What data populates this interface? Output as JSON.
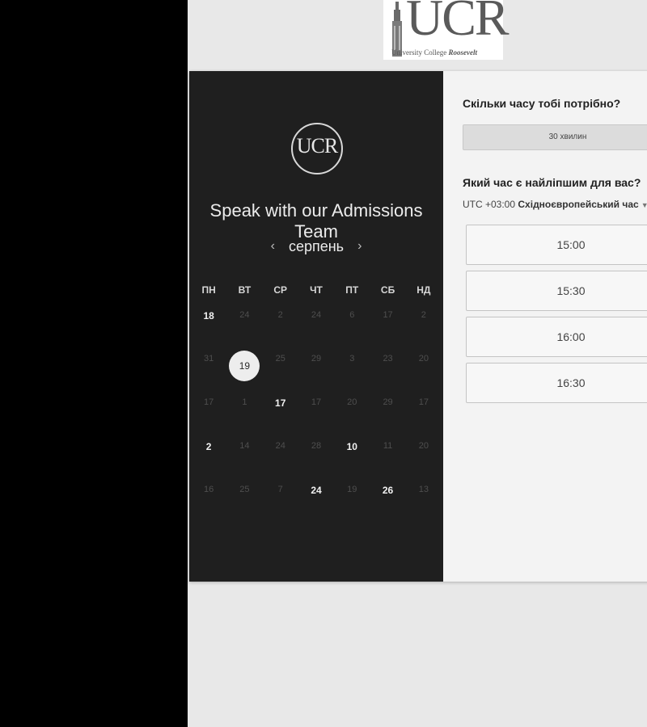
{
  "header": {
    "logo_text": "UCR",
    "logo_subtitle": "University College",
    "logo_subtitle_italic": "Roosevelt"
  },
  "calendar": {
    "badge_text": "UCR",
    "title": "Speak with our Admissions Team",
    "month": "серпень",
    "prev_icon": "chevron-left",
    "next_icon": "chevron-right",
    "weekdays": [
      "ПН",
      "ВТ",
      "СР",
      "ЧТ",
      "ПТ",
      "СБ",
      "НД"
    ],
    "weeks": [
      [
        {
          "d": "18",
          "s": "avail"
        },
        {
          "d": "24",
          "s": "off"
        },
        {
          "d": "2",
          "s": "off"
        },
        {
          "d": "24",
          "s": "off"
        },
        {
          "d": "6",
          "s": "off"
        },
        {
          "d": "17",
          "s": "off"
        },
        {
          "d": "2",
          "s": "off"
        }
      ],
      [
        {
          "d": "31",
          "s": "off"
        },
        {
          "d": "19",
          "s": "selected"
        },
        {
          "d": "25",
          "s": "off"
        },
        {
          "d": "29",
          "s": "off"
        },
        {
          "d": "3",
          "s": "off"
        },
        {
          "d": "23",
          "s": "off"
        },
        {
          "d": "20",
          "s": "off"
        }
      ],
      [
        {
          "d": "17",
          "s": "off"
        },
        {
          "d": "1",
          "s": "off"
        },
        {
          "d": "17",
          "s": "avail"
        },
        {
          "d": "17",
          "s": "off"
        },
        {
          "d": "20",
          "s": "off"
        },
        {
          "d": "29",
          "s": "off"
        },
        {
          "d": "17",
          "s": "off"
        }
      ],
      [
        {
          "d": "2",
          "s": "avail"
        },
        {
          "d": "14",
          "s": "off"
        },
        {
          "d": "24",
          "s": "off"
        },
        {
          "d": "28",
          "s": "off"
        },
        {
          "d": "10",
          "s": "avail"
        },
        {
          "d": "11",
          "s": "off"
        },
        {
          "d": "20",
          "s": "off"
        }
      ],
      [
        {
          "d": "16",
          "s": "off"
        },
        {
          "d": "25",
          "s": "off"
        },
        {
          "d": "7",
          "s": "off"
        },
        {
          "d": "24",
          "s": "avail"
        },
        {
          "d": "19",
          "s": "off"
        },
        {
          "d": "26",
          "s": "avail"
        },
        {
          "d": "13",
          "s": "off"
        }
      ]
    ]
  },
  "booking": {
    "duration_question": "Скільки часу тобі потрібно?",
    "duration_value": "30 хвилин",
    "time_question": "Який час є найліпшим для вас?",
    "timezone_offset": "UTC +03:00",
    "timezone_name": "Східноєвропейський час",
    "slots": [
      "15:00",
      "15:30",
      "16:00",
      "16:30"
    ]
  },
  "colors": {
    "calendar_bg": "#1f1f1f",
    "panel_bg": "#f3f3f3",
    "page_bg": "#e8e8e8"
  }
}
